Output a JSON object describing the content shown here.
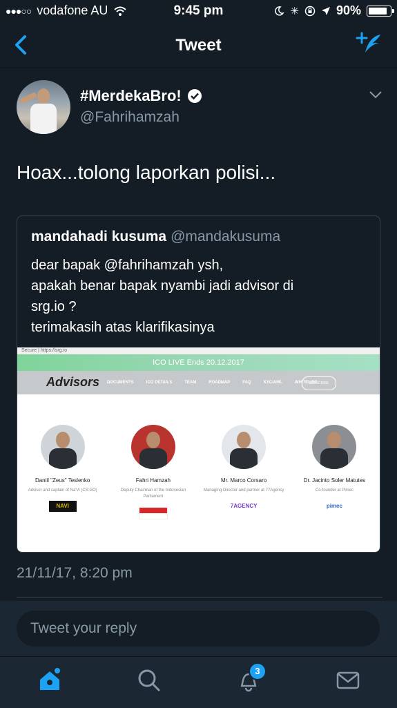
{
  "status_bar": {
    "carrier": "vodafone AU",
    "time": "9:45 pm",
    "battery": "90%",
    "battery_level": 0.9
  },
  "nav": {
    "title": "Tweet"
  },
  "tweet": {
    "display_name": "#MerdekaBro!",
    "handle": "@Fahrihamzah",
    "text": "Hoax...tolong laporkan polisi...",
    "timestamp": "21/11/17, 8:20 pm"
  },
  "quoted_tweet": {
    "name": "mandahadi kusuma",
    "handle": "@mandakusuma",
    "lines": [
      "dear bapak @fahrihamzah ysh,",
      "apakah benar bapak nyambi jadi advisor di",
      "srg.io ?",
      "terimakasih atas klarifikasinya"
    ],
    "image": {
      "url_text": "Secure | https://srg.io",
      "banner": "ICO LIVE Ends 20.12.2017",
      "logo": "Advisors",
      "menu": [
        "DOCUMENTS",
        "ICO DETAILS",
        "TEAM",
        "ROADMAP",
        "FAQ",
        "KYC/AML",
        "WHITELIST"
      ],
      "subscribe": "SUBSCRIBE",
      "people": [
        {
          "name": "Daniil \"Zeus\" Teslenko",
          "role": "Advisor and captain of Na'Vi (CS:GO)",
          "logo": "NAVI",
          "logo_color": "#d4b800"
        },
        {
          "name": "Fahri Hamzah",
          "role": "Deputy Chairman of the Indonesian Parliament",
          "logo": "",
          "logo_color": "#d62828"
        },
        {
          "name": "Mr. Marco Corsaro",
          "role": "Managing Director and partner at 77Agency",
          "logo": "7AGENCY",
          "logo_color": "#7a3bd1"
        },
        {
          "name": "Dr. Jacinto Soler Matutes",
          "role": "Co-founder at Pimec",
          "logo": "pimec",
          "logo_color": "#2b6cc4"
        }
      ]
    }
  },
  "reply": {
    "placeholder": "Tweet your reply"
  },
  "tabbar": {
    "notifications_badge": "3"
  },
  "colors": {
    "background": "#141d26",
    "accent": "#1da1f2",
    "muted": "#8899a6"
  }
}
